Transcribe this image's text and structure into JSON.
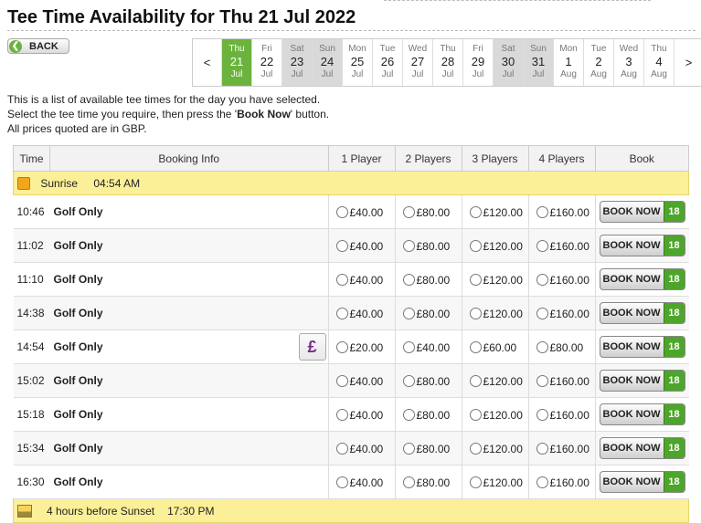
{
  "page": {
    "title": "Tee Time Availability for Thu 21 Jul 2022"
  },
  "nav": {
    "back_label": "BACK",
    "prev_label": "<",
    "next_label": ">"
  },
  "dates": [
    {
      "dow": "Thu",
      "day": "21",
      "mon": "Jul",
      "state": "selected"
    },
    {
      "dow": "Fri",
      "day": "22",
      "mon": "Jul",
      "state": "normal"
    },
    {
      "dow": "Sat",
      "day": "23",
      "mon": "Jul",
      "state": "weekend"
    },
    {
      "dow": "Sun",
      "day": "24",
      "mon": "Jul",
      "state": "weekend"
    },
    {
      "dow": "Mon",
      "day": "25",
      "mon": "Jul",
      "state": "normal"
    },
    {
      "dow": "Tue",
      "day": "26",
      "mon": "Jul",
      "state": "normal"
    },
    {
      "dow": "Wed",
      "day": "27",
      "mon": "Jul",
      "state": "normal"
    },
    {
      "dow": "Thu",
      "day": "28",
      "mon": "Jul",
      "state": "normal"
    },
    {
      "dow": "Fri",
      "day": "29",
      "mon": "Jul",
      "state": "normal"
    },
    {
      "dow": "Sat",
      "day": "30",
      "mon": "Jul",
      "state": "weekend"
    },
    {
      "dow": "Sun",
      "day": "31",
      "mon": "Jul",
      "state": "weekend"
    },
    {
      "dow": "Mon",
      "day": "1",
      "mon": "Aug",
      "state": "normal"
    },
    {
      "dow": "Tue",
      "day": "2",
      "mon": "Aug",
      "state": "normal"
    },
    {
      "dow": "Wed",
      "day": "3",
      "mon": "Aug",
      "state": "normal"
    },
    {
      "dow": "Thu",
      "day": "4",
      "mon": "Aug",
      "state": "normal"
    }
  ],
  "intro": {
    "line1": "This is a list of available tee times for the day you have selected.",
    "line2_pre": "Select the tee time you require, then press the '",
    "line2_bold": "Book Now",
    "line2_post": "' button.",
    "line3": "All prices quoted are in GBP."
  },
  "table": {
    "headers": [
      "Time",
      "Booking Info",
      "1 Player",
      "2 Players",
      "3 Players",
      "4 Players",
      "Book"
    ],
    "sunrise": {
      "label": "Sunrise",
      "time": "04:54 AM"
    },
    "sunset": {
      "label": "4 hours before Sunset",
      "time": "17:30 PM"
    },
    "book_label": "BOOK NOW",
    "flag_label": "18",
    "rows": [
      {
        "time": "10:46",
        "info": "Golf Only",
        "prices": [
          "£40.00",
          "£80.00",
          "£120.00",
          "£160.00"
        ],
        "pound": false
      },
      {
        "time": "11:02",
        "info": "Golf Only",
        "prices": [
          "£40.00",
          "£80.00",
          "£120.00",
          "£160.00"
        ],
        "pound": false
      },
      {
        "time": "11:10",
        "info": "Golf Only",
        "prices": [
          "£40.00",
          "£80.00",
          "£120.00",
          "£160.00"
        ],
        "pound": false
      },
      {
        "time": "14:38",
        "info": "Golf Only",
        "prices": [
          "£40.00",
          "£80.00",
          "£120.00",
          "£160.00"
        ],
        "pound": false
      },
      {
        "time": "14:54",
        "info": "Golf Only",
        "prices": [
          "£20.00",
          "£40.00",
          "£60.00",
          "£80.00"
        ],
        "pound": true,
        "pound_symbol": "£"
      },
      {
        "time": "15:02",
        "info": "Golf Only",
        "prices": [
          "£40.00",
          "£80.00",
          "£120.00",
          "£160.00"
        ],
        "pound": false
      },
      {
        "time": "15:18",
        "info": "Golf Only",
        "prices": [
          "£40.00",
          "£80.00",
          "£120.00",
          "£160.00"
        ],
        "pound": false
      },
      {
        "time": "15:34",
        "info": "Golf Only",
        "prices": [
          "£40.00",
          "£80.00",
          "£120.00",
          "£160.00"
        ],
        "pound": false
      },
      {
        "time": "16:30",
        "info": "Golf Only",
        "prices": [
          "£40.00",
          "£80.00",
          "£120.00",
          "£160.00"
        ],
        "pound": false
      }
    ]
  }
}
